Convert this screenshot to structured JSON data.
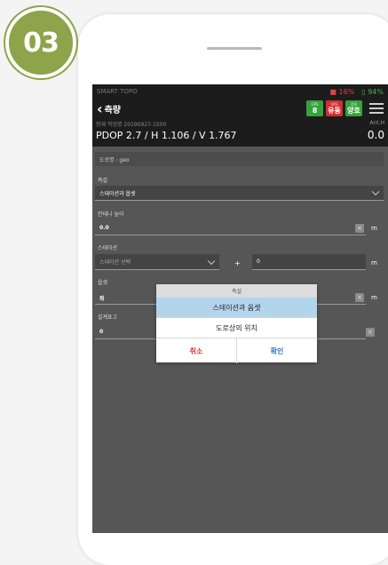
{
  "step": "03",
  "status_bar": {
    "app_name": "SMART TOPO",
    "battery_left": "■ 16%",
    "battery_right": "▯ 94%"
  },
  "app_bar": {
    "title": "측량",
    "badges": [
      {
        "key": "GPS",
        "value": "8"
      },
      {
        "key": "VRS",
        "value": "유동"
      },
      {
        "key": "정밀",
        "value": "양호"
      }
    ]
  },
  "info": {
    "file_name": "현재 작업명 20190927-1500",
    "precision": "PDOP 2.7 / H 1.106 / V 1.767",
    "ant_label": "Ant.H",
    "ant_value": "0.0"
  },
  "form": {
    "road_name": "도로명 : geo",
    "survey_label": "측설",
    "survey_value": "스테이션과 옵셋",
    "antenna_label": "안테나 높이",
    "antenna_value": "0.0",
    "unit_m": "m",
    "station_label": "스테이션",
    "station_placeholder": "스테이션 선택",
    "station_plus": "+",
    "station_value": "0",
    "offset_label": "옵셋",
    "offset_value": "좌",
    "design_label": "설계표고",
    "design_value": "0",
    "clear_glyph": "×"
  },
  "dialog": {
    "title": "측설",
    "options": [
      "스테이션과 옵셋",
      "도로상의 위치"
    ],
    "cancel": "취소",
    "confirm": "확인"
  }
}
